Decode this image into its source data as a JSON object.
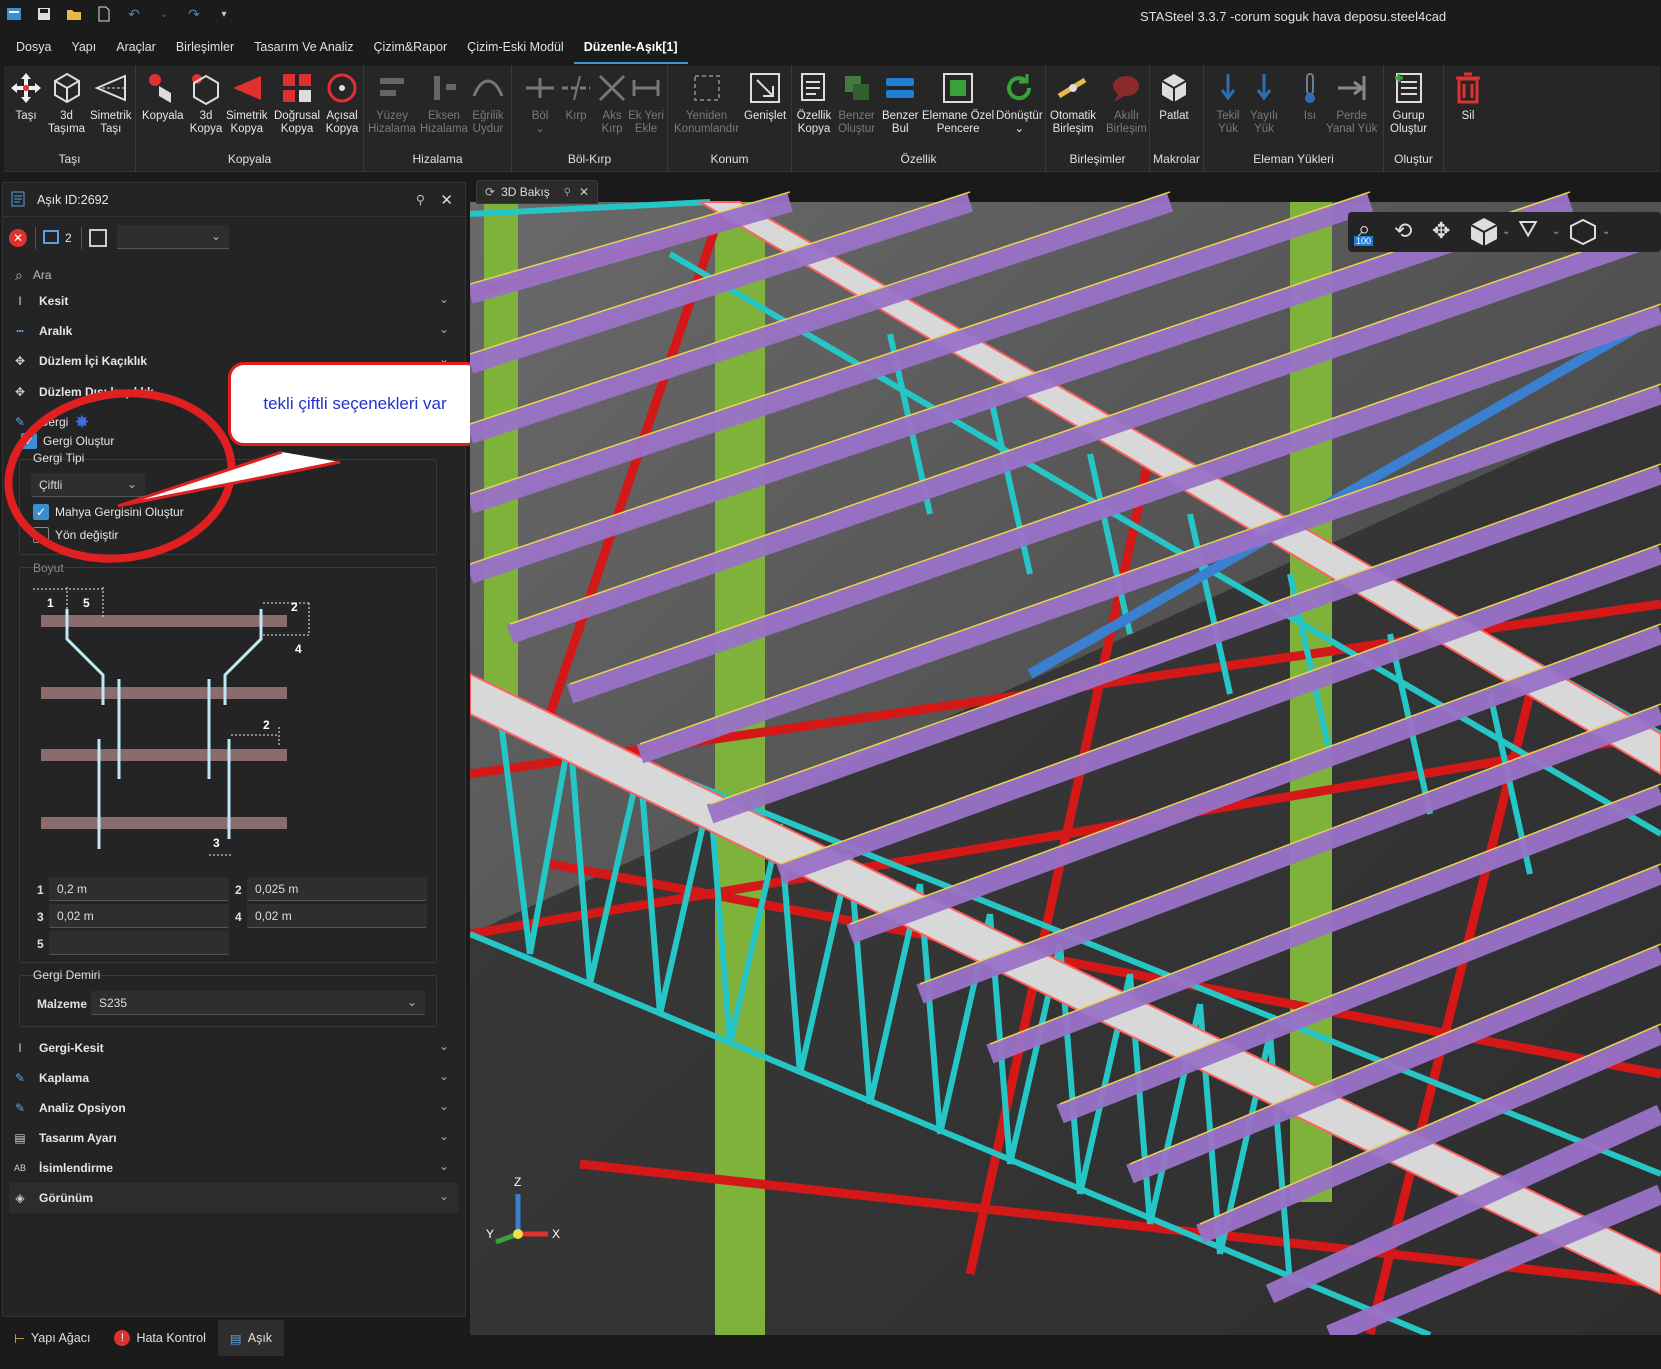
{
  "app": {
    "title": "STASteel 3.3.7 -corum soguk hava deposu.steel4cad"
  },
  "menu": [
    "Dosya",
    "Yapı",
    "Araçlar",
    "Birleşimler",
    "Tasarım Ve Analiz",
    "Çizim&Rapor",
    "Çizim-Eski Modül",
    "Düzenle-Aşık[1]"
  ],
  "ribbon": {
    "tasi": {
      "label": "Taşı",
      "b1": "Taşı",
      "b2a": "3d",
      "b2b": "Taşıma",
      "b3a": "Simetrik",
      "b3b": "Taşı"
    },
    "kopyala": {
      "label": "Kopyala",
      "b1": "Kopyala",
      "b2a": "3d",
      "b2b": "Kopya",
      "b3a": "Simetrik",
      "b3b": "Kopya",
      "b4a": "Doğrusal",
      "b4b": "Kopya",
      "b5a": "Açısal",
      "b5b": "Kopya"
    },
    "hizalama": {
      "label": "Hizalama",
      "b1a": "Yüzey",
      "b1b": "Hizalama",
      "b2a": "Eksen",
      "b2b": "Hizalama",
      "b3a": "Eğrilik",
      "b3b": "Uydur"
    },
    "bolkirp": {
      "label": "Böl-Kırp",
      "b1": "Böl",
      "b2": "Kırp",
      "b3a": "Aks",
      "b3b": "Kırp",
      "b4a": "Ek Yeri",
      "b4b": "Ekle"
    },
    "konum": {
      "label": "Konum",
      "b1a": "Yeniden",
      "b1b": "Konumlandır",
      "b2": "Genişlet"
    },
    "ozellik": {
      "label": "Özellik",
      "b1a": "Özellik",
      "b1b": "Kopya",
      "b2a": "Benzer",
      "b2b": "Oluştur",
      "b3a": "Benzer",
      "b3b": "Bul",
      "b4a": "Elemane Özel",
      "b4b": "Pencere",
      "b5": "Dönüştür"
    },
    "birlesimler": {
      "label": "Birleşimler",
      "b1a": "Otomatik",
      "b1b": "Birleşim",
      "b2a": "Akıllı",
      "b2b": "Birleşim"
    },
    "makrolar": {
      "label": "Makrolar",
      "b1": "Patlat"
    },
    "yukler": {
      "label": "Eleman Yükleri",
      "b1a": "Tekil",
      "b1b": "Yük",
      "b2a": "Yayılı",
      "b2b": "Yük",
      "b3": "Isı",
      "b4a": "Perde",
      "b4b": "Yanal Yük"
    },
    "olustur": {
      "label": "Oluştur",
      "b1a": "Gurup",
      "b1b": "Oluştur"
    },
    "sil": {
      "b1": "Sil"
    }
  },
  "panel": {
    "title": "Aşık ID:2692",
    "count": "2",
    "search_placeholder": "Ara",
    "sections": {
      "kesit": "Kesit",
      "aralik": "Aralık",
      "duzlem_ici": "Düzlem İçi Kaçıklık",
      "duzlem_disi": "Düzlem Dışı kaçıklık",
      "gergi": "Gergi",
      "gergi_kesit": "Gergi-Kesit",
      "kaplama": "Kaplama",
      "analiz": "Analiz Opsiyon",
      "tasarim": "Tasarım Ayarı",
      "isim": "İsimlendirme",
      "gorunum": "Görünüm"
    },
    "gergi_olustur": "Gergi Oluştur",
    "gergi_tipi_label": "Gergi Tipi",
    "gergi_tipi_value": "Çiftli",
    "mahya": "Mahya Gergisini Oluştur",
    "yon": "Yön değiştir",
    "boyut_label": "Boyut",
    "dims": {
      "n1": "1",
      "n2": "2",
      "n3": "3",
      "n4": "4",
      "n5": "5",
      "v1": "0,2 m",
      "v2": "0,025 m",
      "v3": "0,02 m",
      "v4": "0,02 m",
      "v5": ""
    },
    "gergi_demiri_label": "Gergi Demiri",
    "malzeme_label": "Malzeme",
    "malzeme_value": "S235"
  },
  "bottom_tabs": [
    "Yapı Ağacı",
    "Hata Kontrol",
    "Aşık"
  ],
  "view": {
    "tab": "3D Bakış",
    "zoom": "100",
    "axes": {
      "x": "X",
      "y": "Y",
      "z": "Z"
    }
  },
  "callout": "tekli çiftli seçenekleri var",
  "colors": {
    "accent": "#3a8fd1",
    "red": "#e02020",
    "cyan": "#27c6c6",
    "purple": "#9a72c8",
    "green": "#7fb23a"
  }
}
